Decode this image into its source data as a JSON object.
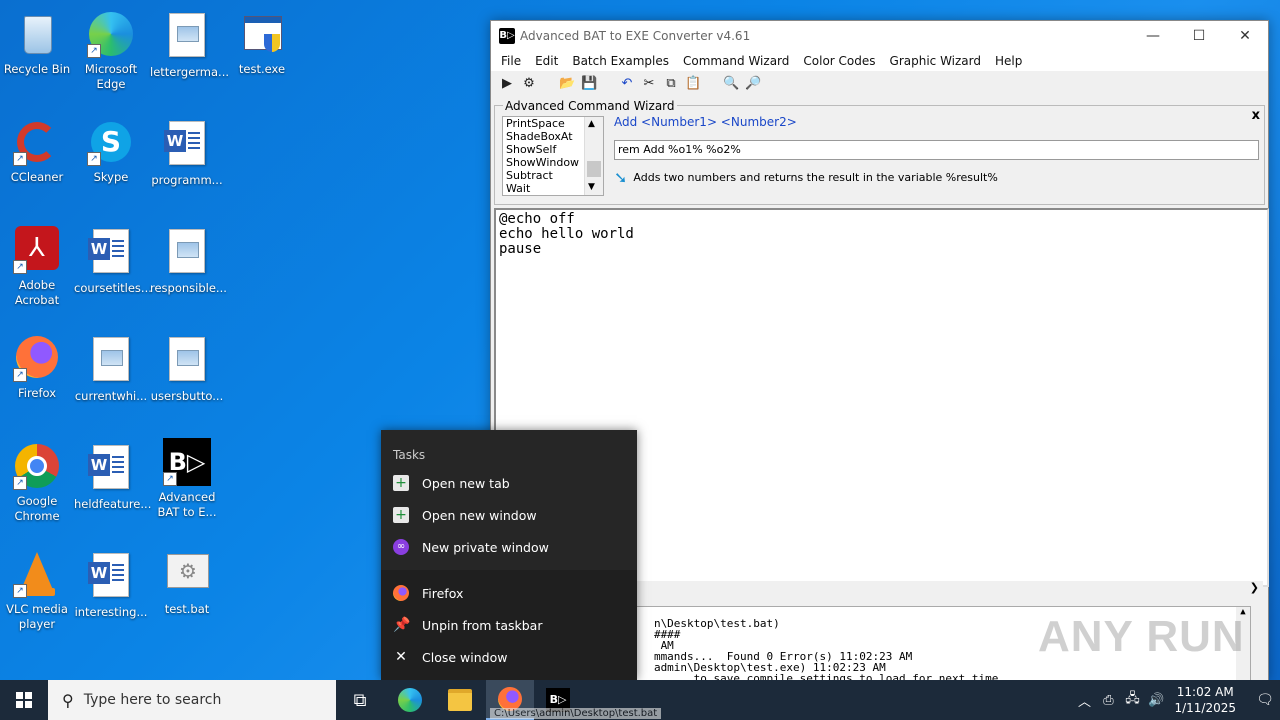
{
  "desktop": {
    "icons": [
      {
        "label": "Recycle Bin"
      },
      {
        "label": "Microsoft Edge"
      },
      {
        "label": "lettergerma..."
      },
      {
        "label": "test.exe"
      },
      {
        "label": "CCleaner"
      },
      {
        "label": "Skype"
      },
      {
        "label": "programm..."
      },
      {
        "label": "Adobe Acrobat"
      },
      {
        "label": "coursetitles..."
      },
      {
        "label": "responsible..."
      },
      {
        "label": "Firefox"
      },
      {
        "label": "currentwhi..."
      },
      {
        "label": "usersbutto..."
      },
      {
        "label": "Google Chrome"
      },
      {
        "label": "heldfeature..."
      },
      {
        "label": "Advanced BAT to E..."
      },
      {
        "label": "VLC media player"
      },
      {
        "label": "interesting..."
      },
      {
        "label": "test.bat"
      }
    ]
  },
  "window": {
    "title": "Advanced BAT to EXE Converter v4.61",
    "menu": [
      "File",
      "Edit",
      "Batch Examples",
      "Command Wizard",
      "Color Codes",
      "Graphic Wizard",
      "Help"
    ],
    "wizard": {
      "legend": "Advanced Command Wizard",
      "close": "x",
      "commands": [
        "PrintSpace",
        "ShadeBoxAt",
        "ShowSelf",
        "ShowWindow",
        "Subtract",
        "Wait"
      ],
      "syntax": "Add  <Number1> <Number2>",
      "input_value": "rem Add %o1% %o2%",
      "description": "Adds two numbers and returns the result in the variable %result%"
    },
    "editor_lines": [
      "@echo off",
      "echo hello world",
      "pause"
    ],
    "output_lines": [
      "                        n\\Desktop\\test.bat)",
      "                        ####",
      "                         AM",
      "                        mmands...  Found 0 Error(s) 11:02:23 AM",
      "",
      "                        admin\\Desktop\\test.exe) 11:02:23 AM",
      "                              to save compile settings to load for next time."
    ]
  },
  "jumplist": {
    "header": "Tasks",
    "tasks": [
      "Open new tab",
      "Open new window",
      "New private window"
    ],
    "app": "Firefox",
    "unpin": "Unpin from taskbar",
    "close": "Close window"
  },
  "taskbar": {
    "search_placeholder": "Type here to search",
    "time": "11:02 AM",
    "date": "1/11/2025",
    "tooltip": "C:\\Users\\admin\\Desktop\\test.bat"
  },
  "watermark": "ANY RUN"
}
